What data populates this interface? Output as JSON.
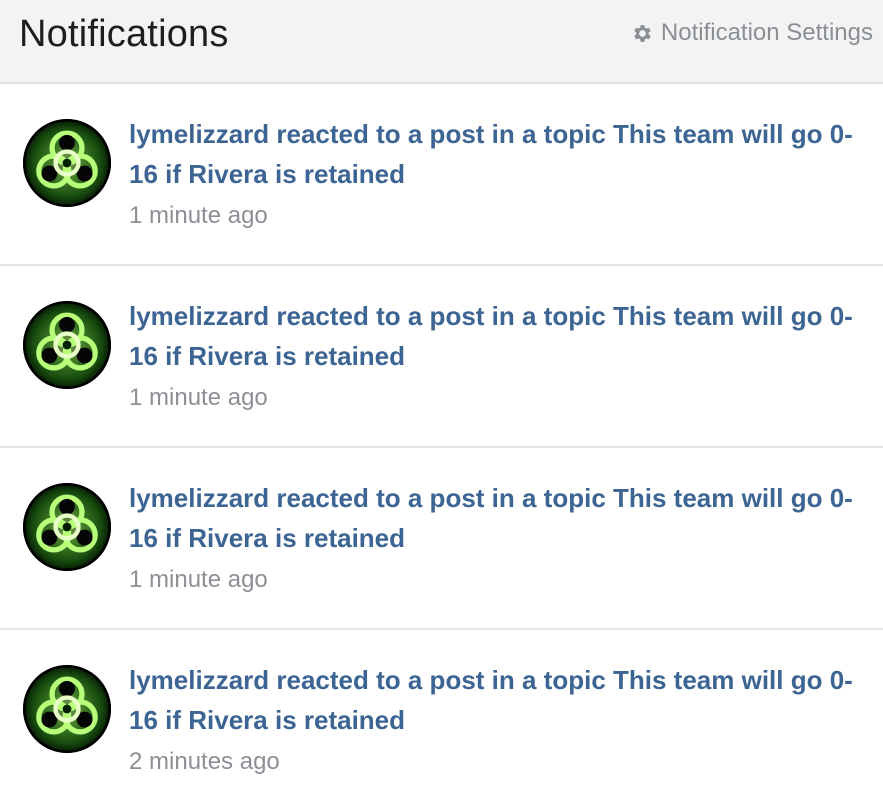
{
  "header": {
    "title": "Notifications",
    "settings_label": "Notification Settings",
    "settings_icon": "gear-icon"
  },
  "colors": {
    "header_bg": "#f3f3f3",
    "link": "#3d6594",
    "muted": "#8c9096",
    "avatar_glow": "#7ee84a"
  },
  "notifications": [
    {
      "avatar_icon": "biohazard-avatar",
      "text": "lymelizzard reacted to a post in a topic This team will go 0-16 if Rivera is retained",
      "time": "1 minute ago"
    },
    {
      "avatar_icon": "biohazard-avatar",
      "text": "lymelizzard reacted to a post in a topic This team will go 0-16 if Rivera is retained",
      "time": "1 minute ago"
    },
    {
      "avatar_icon": "biohazard-avatar",
      "text": "lymelizzard reacted to a post in a topic This team will go 0-16 if Rivera is retained",
      "time": "1 minute ago"
    },
    {
      "avatar_icon": "biohazard-avatar",
      "text": "lymelizzard reacted to a post in a topic This team will go 0-16 if Rivera is retained",
      "time": "2 minutes ago"
    }
  ]
}
